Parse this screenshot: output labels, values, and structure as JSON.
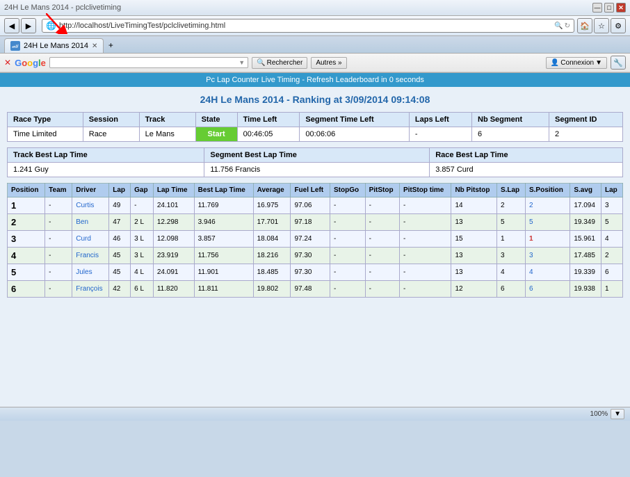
{
  "browser": {
    "title_bar": {
      "title": "24H Le Mans 2014 - pclclivetiming",
      "minimize": "—",
      "maximize": "□",
      "close": "✕"
    },
    "address": {
      "url": "http://localhost/LiveTimingTest/pclclivetiming.html",
      "icon": "🌐"
    },
    "tab": {
      "label": "24H Le Mans 2014",
      "close": "✕"
    },
    "google": {
      "logo": "Google",
      "search_placeholder": "",
      "search_btn": "Rechercher",
      "autres": "Autres »",
      "connexion": "Connexion"
    }
  },
  "page": {
    "refresh_banner": "Pc Lap Counter Live Timing - Refresh Leaderboard in 0 seconds",
    "race_title": "24H Le Mans 2014 - Ranking at 3/09/2014 09:14:08",
    "info": {
      "headers": [
        "Race Type",
        "Session",
        "Track",
        "State",
        "Time Left",
        "Segment Time Left",
        "Laps Left",
        "Nb Segment",
        "Segment ID"
      ],
      "values": [
        "Time Limited",
        "Race",
        "Le Mans",
        "Start",
        "00:46:05",
        "00:06:06",
        "-",
        "6",
        "2"
      ]
    },
    "best_laps": {
      "track_best_label": "Track Best Lap Time",
      "segment_best_label": "Segment Best Lap Time",
      "race_best_label": "Race Best Lap Time",
      "track_best_value": "1.241 Guy",
      "segment_best_value": "11.756 Francis",
      "race_best_value": "3.857 Curd"
    },
    "results": {
      "headers": [
        "Position",
        "Team",
        "Driver",
        "Lap",
        "Gap",
        "Lap Time",
        "Best Lap Time",
        "Average",
        "Fuel Left",
        "StopGo",
        "PitStop",
        "PitStop time",
        "Nb Pitstop",
        "S.Lap",
        "S.Position",
        "S.avg",
        "Lap"
      ],
      "rows": [
        {
          "position": "1",
          "team": "-",
          "driver": "Curtis",
          "lap": "49",
          "gap": "-",
          "lap_time": "24.101",
          "best_lap": "11.769",
          "average": "16.975",
          "fuel": "97.06",
          "stopgo": "-",
          "pitstop": "-",
          "pitstop_time": "-",
          "nb_pitstop": "14",
          "s_lap": "2",
          "s_position": "2",
          "s_avg": "17.094",
          "lap2": "3"
        },
        {
          "position": "2",
          "team": "-",
          "driver": "Ben",
          "lap": "47",
          "gap": "2 L",
          "lap_time": "12.298",
          "best_lap": "3.946",
          "average": "17.701",
          "fuel": "97.18",
          "stopgo": "-",
          "pitstop": "-",
          "pitstop_time": "-",
          "nb_pitstop": "13",
          "s_lap": "5",
          "s_position": "5",
          "s_avg": "19.349",
          "lap2": "5"
        },
        {
          "position": "3",
          "team": "-",
          "driver": "Curd",
          "lap": "46",
          "gap": "3 L",
          "lap_time": "12.098",
          "best_lap": "3.857",
          "average": "18.084",
          "fuel": "97.24",
          "stopgo": "-",
          "pitstop": "-",
          "pitstop_time": "-",
          "nb_pitstop": "15",
          "s_lap": "1",
          "s_position": "1",
          "s_avg": "15.961",
          "lap2": "4"
        },
        {
          "position": "4",
          "team": "-",
          "driver": "Francis",
          "lap": "45",
          "gap": "3 L",
          "lap_time": "23.919",
          "best_lap": "11.756",
          "average": "18.216",
          "fuel": "97.30",
          "stopgo": "-",
          "pitstop": "-",
          "pitstop_time": "-",
          "nb_pitstop": "13",
          "s_lap": "3",
          "s_position": "3",
          "s_avg": "17.485",
          "lap2": "2"
        },
        {
          "position": "5",
          "team": "-",
          "driver": "Jules",
          "lap": "45",
          "gap": "4 L",
          "lap_time": "24.091",
          "best_lap": "11.901",
          "average": "18.485",
          "fuel": "97.30",
          "stopgo": "-",
          "pitstop": "-",
          "pitstop_time": "-",
          "nb_pitstop": "13",
          "s_lap": "4",
          "s_position": "4",
          "s_avg": "19.339",
          "lap2": "6"
        },
        {
          "position": "6",
          "team": "-",
          "driver": "François",
          "lap": "42",
          "gap": "6 L",
          "lap_time": "11.820",
          "best_lap": "11.811",
          "average": "19.802",
          "fuel": "97.48",
          "stopgo": "-",
          "pitstop": "-",
          "pitstop_time": "-",
          "nb_pitstop": "12",
          "s_lap": "6",
          "s_position": "6",
          "s_avg": "19.938",
          "lap2": "1"
        }
      ]
    },
    "status_bar": {
      "zoom": "100%"
    }
  }
}
